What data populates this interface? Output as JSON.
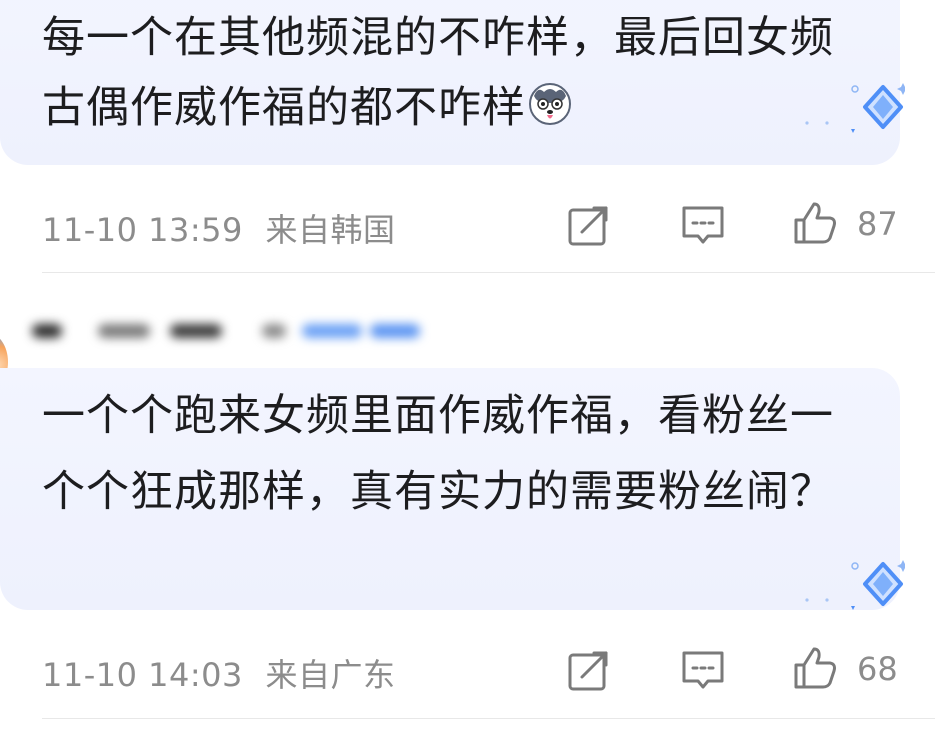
{
  "comments": [
    {
      "text": "每一个在其他频混的不咋样，最后回女频古偶作威作福的都不咋样",
      "emoji": "husky-emoji",
      "time": "11-10 13:59",
      "location": "来自韩国",
      "likes": "87"
    },
    {
      "username": "",
      "text": "一个个跑来女频里面作威作福，看粉丝一个个狂成那样，真有实力的需要粉丝闹？",
      "time": "11-10 14:03",
      "location": "来自广东",
      "likes": "68"
    }
  ],
  "icons": {
    "repost": "repost-icon",
    "comment": "comment-icon",
    "like": "like-thumb-icon",
    "badge": "diamond-badge-icon"
  },
  "colors": {
    "bubble_bg": "#eef1fd",
    "text": "#1d1d1f",
    "meta": "#8c8c8c",
    "badge_blue": "#4f8ff7"
  }
}
